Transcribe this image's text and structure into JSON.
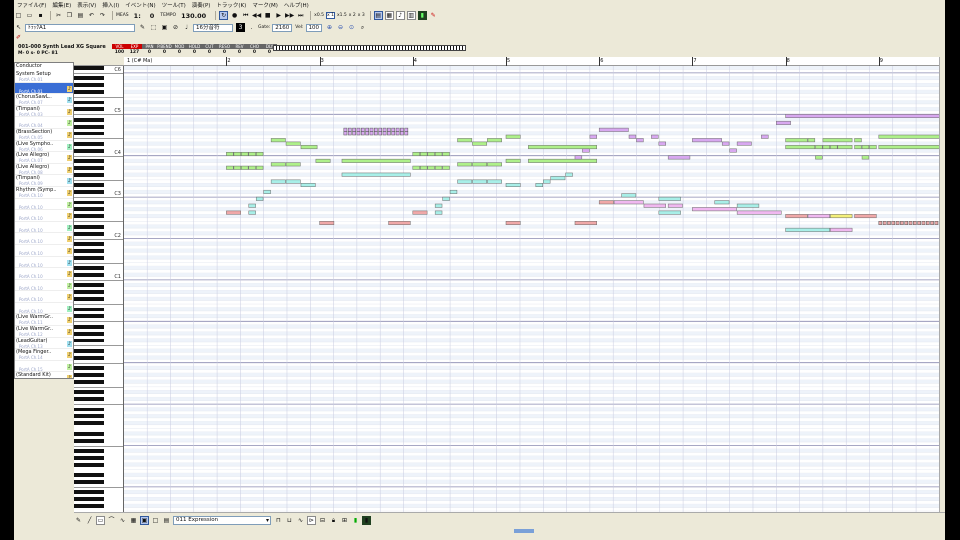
{
  "menu": [
    "ファイル(F)",
    "編集(E)",
    "表示(V)",
    "挿入(I)",
    "イベント(N)",
    "ツール(T)",
    "演奏(P)",
    "トラック(K)",
    "マーク(M)",
    "ヘルプ(H)"
  ],
  "toolbar": {
    "meas_label": "MEAS",
    "position": "1:",
    "tick": "0",
    "tempo_label": "TEMPO",
    "tempo": "130.00",
    "zoom_x05": "x0.5",
    "zoom_x1": "x 1",
    "zoom_x15": "x1.5",
    "zoom_x2": "x 2",
    "zoom_x3": "x 3"
  },
  "toolbar2": {
    "track_select": "ﾄﾗｯｸA1",
    "note_length": "16分音符",
    "gate_label": "Gate:",
    "gate": "2160",
    "vel_label": "Vel:",
    "vel": "100"
  },
  "track": {
    "name": "001-000 Synth Lead XG Square",
    "numbers": "M- 0 s- 0 PC- 81",
    "params": [
      {
        "label": "VOL",
        "value": "100",
        "red": true
      },
      {
        "label": "EXP",
        "value": "127",
        "red": true
      },
      {
        "label": "PAN",
        "value": "0"
      },
      {
        "label": "P.BEND",
        "value": "0"
      },
      {
        "label": "MOD",
        "value": "0"
      },
      {
        "label": "HOLD",
        "value": "0"
      },
      {
        "label": "CUT",
        "value": "0"
      },
      {
        "label": "RESO",
        "value": "0"
      },
      {
        "label": "REV",
        "value": "0"
      },
      {
        "label": "CHO",
        "value": "0"
      },
      {
        "label": "DLY",
        "value": "0"
      }
    ]
  },
  "tracklist": {
    "conductor": "Conductor",
    "tracks": [
      {
        "name": "System Setup",
        "port": "PortA Ch.01",
        "icon": ""
      },
      {
        "name": "",
        "port": "PortA Ch.01",
        "icon": "a",
        "selected": true
      },
      {
        "name": "(ChorusSawL..",
        "port": "PortA Ch.07",
        "icon": "a"
      },
      {
        "name": "(Timpani)",
        "port": "PortA Ch.03",
        "icon": "a"
      },
      {
        "name": "",
        "port": "PortA Ch.04",
        "icon": "a"
      },
      {
        "name": "(BrassSection)",
        "port": "PortA Ch.05",
        "icon": "a"
      },
      {
        "name": "(Live Sympho..",
        "port": "PortA Ch.06",
        "icon": "a"
      },
      {
        "name": "(Live Allegro)",
        "port": "PortA Ch.07",
        "icon": "a"
      },
      {
        "name": "(Live Allegro)",
        "port": "PortA Ch.08",
        "icon": "a"
      },
      {
        "name": "(Timpani)",
        "port": "PortA Ch.09",
        "icon": "a"
      },
      {
        "name": "Rhythm (Symp..",
        "port": "PortA Ch.10",
        "icon": "a"
      },
      {
        "name": "",
        "port": "PortA Ch.10",
        "icon": "a"
      },
      {
        "name": "",
        "port": "PortA Ch.10",
        "icon": "a"
      },
      {
        "name": "",
        "port": "PortA Ch.10",
        "icon": "a"
      },
      {
        "name": "",
        "port": "PortA Ch.10",
        "icon": "a"
      },
      {
        "name": "",
        "port": "PortA Ch.10",
        "icon": "a"
      },
      {
        "name": "",
        "port": "PortA Ch.10",
        "icon": "a"
      },
      {
        "name": "",
        "port": "PortA Ch.10",
        "icon": "a"
      },
      {
        "name": "",
        "port": "PortA Ch.10",
        "icon": "a"
      },
      {
        "name": "",
        "port": "PortA Ch.10",
        "icon": "a"
      },
      {
        "name": "",
        "port": "PortA Ch.10",
        "icon": "a"
      },
      {
        "name": "(Live WarmGr..",
        "port": "PortA Ch.11",
        "icon": "a"
      },
      {
        "name": "(Live WarmGr..",
        "port": "PortA Ch.12",
        "icon": "a"
      },
      {
        "name": "(LeadGuitar)",
        "port": "PortA Ch.13",
        "icon": "a"
      },
      {
        "name": "(Mega Finger..",
        "port": "PortA Ch.14",
        "icon": "a"
      },
      {
        "name": "",
        "port": "PortA Ch.15",
        "icon": "a"
      },
      {
        "name": "(Standard Kit)",
        "port": "PortA Ch.16",
        "icon": "a"
      },
      {
        "name": "",
        "port": "PortA Ch.16",
        "icon": "a"
      }
    ]
  },
  "ruler": {
    "marker": "1 (C# Ma)",
    "measures": [
      "2",
      "3",
      "4",
      "5",
      "6",
      "7",
      "8",
      "9"
    ]
  },
  "keyboard": {
    "octaves": [
      "C7",
      "C6",
      "C5",
      "C4",
      "C3",
      "C2",
      "C1"
    ]
  },
  "colors": {
    "cyan": "#a8efe8",
    "green": "#aef08a",
    "pink": "#f0a8a8",
    "purple": "#d8a8f0",
    "magenta": "#f0b8f0",
    "yellow": "#f4f07a",
    "red": "#e8a8a8"
  },
  "notes": [
    {
      "c": "purple",
      "m": 2.26,
      "p": 80,
      "l": 0.7,
      "t": "blocks"
    },
    {
      "c": "purple",
      "m": 2.26,
      "p": 79,
      "l": 0.7,
      "t": "blocks"
    },
    {
      "c": "green",
      "m": 1.48,
      "p": 77,
      "l": 0.16
    },
    {
      "c": "green",
      "m": 1.64,
      "p": 76,
      "l": 0.16
    },
    {
      "c": "green",
      "m": 1.0,
      "p": 73,
      "l": 0.08
    },
    {
      "c": "green",
      "m": 1.08,
      "p": 73,
      "l": 0.08
    },
    {
      "c": "green",
      "m": 1.16,
      "p": 73,
      "l": 0.08
    },
    {
      "c": "green",
      "m": 1.24,
      "p": 73,
      "l": 0.08
    },
    {
      "c": "green",
      "m": 1.32,
      "p": 73,
      "l": 0.08
    },
    {
      "c": "green",
      "m": 1.8,
      "p": 75,
      "l": 0.18
    },
    {
      "c": "green",
      "m": 1.0,
      "p": 69,
      "l": 0.08
    },
    {
      "c": "green",
      "m": 1.08,
      "p": 69,
      "l": 0.08
    },
    {
      "c": "green",
      "m": 1.16,
      "p": 69,
      "l": 0.08
    },
    {
      "c": "green",
      "m": 1.24,
      "p": 69,
      "l": 0.08
    },
    {
      "c": "green",
      "m": 1.32,
      "p": 69,
      "l": 0.08
    },
    {
      "c": "green",
      "m": 1.48,
      "p": 70,
      "l": 0.16
    },
    {
      "c": "green",
      "m": 1.64,
      "p": 70,
      "l": 0.16
    },
    {
      "c": "green",
      "m": 1.96,
      "p": 71,
      "l": 0.16
    },
    {
      "c": "green",
      "m": 2.24,
      "p": 71,
      "l": 0.74
    },
    {
      "c": "cyan",
      "m": 1.48,
      "p": 65,
      "l": 0.16
    },
    {
      "c": "cyan",
      "m": 1.64,
      "p": 65,
      "l": 0.16
    },
    {
      "c": "cyan",
      "m": 1.8,
      "p": 64,
      "l": 0.16
    },
    {
      "c": "cyan",
      "m": 2.24,
      "p": 67,
      "l": 0.74
    },
    {
      "c": "cyan",
      "m": 1.4,
      "p": 62,
      "l": 0.08
    },
    {
      "c": "cyan",
      "m": 1.32,
      "p": 60,
      "l": 0.08
    },
    {
      "c": "cyan",
      "m": 1.24,
      "p": 58,
      "l": 0.08
    },
    {
      "c": "pink",
      "m": 1.0,
      "p": 56,
      "l": 0.16
    },
    {
      "c": "cyan",
      "m": 1.24,
      "p": 56,
      "l": 0.08
    },
    {
      "c": "pink",
      "m": 2.0,
      "p": 53,
      "l": 0.16
    },
    {
      "c": "pink",
      "m": 2.74,
      "p": 53,
      "l": 0.24
    },
    {
      "c": "green",
      "m": 3.48,
      "p": 77,
      "l": 0.16
    },
    {
      "c": "green",
      "m": 3.64,
      "p": 76,
      "l": 0.16
    },
    {
      "c": "green",
      "m": 3.8,
      "p": 77,
      "l": 0.16
    },
    {
      "c": "green",
      "m": 3.0,
      "p": 73,
      "l": 0.08
    },
    {
      "c": "green",
      "m": 3.08,
      "p": 73,
      "l": 0.08
    },
    {
      "c": "green",
      "m": 3.16,
      "p": 73,
      "l": 0.08
    },
    {
      "c": "green",
      "m": 3.24,
      "p": 73,
      "l": 0.08
    },
    {
      "c": "green",
      "m": 3.32,
      "p": 73,
      "l": 0.08
    },
    {
      "c": "green",
      "m": 3.0,
      "p": 69,
      "l": 0.08
    },
    {
      "c": "green",
      "m": 3.08,
      "p": 69,
      "l": 0.08
    },
    {
      "c": "green",
      "m": 3.16,
      "p": 69,
      "l": 0.08
    },
    {
      "c": "green",
      "m": 3.24,
      "p": 69,
      "l": 0.08
    },
    {
      "c": "green",
      "m": 3.32,
      "p": 69,
      "l": 0.08
    },
    {
      "c": "green",
      "m": 3.48,
      "p": 70,
      "l": 0.16
    },
    {
      "c": "green",
      "m": 3.64,
      "p": 70,
      "l": 0.16
    },
    {
      "c": "green",
      "m": 3.8,
      "p": 70,
      "l": 0.16
    },
    {
      "c": "cyan",
      "m": 3.48,
      "p": 65,
      "l": 0.16
    },
    {
      "c": "cyan",
      "m": 3.64,
      "p": 65,
      "l": 0.16
    },
    {
      "c": "cyan",
      "m": 3.8,
      "p": 65,
      "l": 0.16
    },
    {
      "c": "cyan",
      "m": 3.4,
      "p": 62,
      "l": 0.08
    },
    {
      "c": "cyan",
      "m": 3.32,
      "p": 60,
      "l": 0.08
    },
    {
      "c": "cyan",
      "m": 3.24,
      "p": 58,
      "l": 0.08
    },
    {
      "c": "pink",
      "m": 3.0,
      "p": 56,
      "l": 0.16
    },
    {
      "c": "cyan",
      "m": 3.24,
      "p": 56,
      "l": 0.08
    },
    {
      "c": "pink",
      "m": 4.0,
      "p": 53,
      "l": 0.16
    },
    {
      "c": "pink",
      "m": 4.74,
      "p": 53,
      "l": 0.24
    },
    {
      "c": "green",
      "m": 4.0,
      "p": 78,
      "l": 0.16
    },
    {
      "c": "green",
      "m": 4.0,
      "p": 71,
      "l": 0.16
    },
    {
      "c": "green",
      "m": 4.24,
      "p": 75,
      "l": 0.74
    },
    {
      "c": "green",
      "m": 4.24,
      "p": 71,
      "l": 0.74
    },
    {
      "c": "cyan",
      "m": 4.0,
      "p": 64,
      "l": 0.16
    },
    {
      "c": "cyan",
      "m": 4.32,
      "p": 64,
      "l": 0.08
    },
    {
      "c": "cyan",
      "m": 4.4,
      "p": 65,
      "l": 0.08
    },
    {
      "c": "cyan",
      "m": 4.48,
      "p": 66,
      "l": 0.16
    },
    {
      "c": "cyan",
      "m": 4.64,
      "p": 67,
      "l": 0.08
    },
    {
      "c": "purple",
      "m": 4.74,
      "p": 72,
      "l": 0.08
    },
    {
      "c": "purple",
      "m": 4.82,
      "p": 74,
      "l": 0.08
    },
    {
      "c": "purple",
      "m": 4.9,
      "p": 78,
      "l": 0.08
    },
    {
      "c": "purple",
      "m": 5.0,
      "p": 80,
      "l": 0.32
    },
    {
      "c": "purple",
      "m": 5.32,
      "p": 78,
      "l": 0.08
    },
    {
      "c": "purple",
      "m": 5.4,
      "p": 77,
      "l": 0.08
    },
    {
      "c": "purple",
      "m": 5.56,
      "p": 78,
      "l": 0.08
    },
    {
      "c": "purple",
      "m": 5.64,
      "p": 76,
      "l": 0.08
    },
    {
      "c": "purple",
      "m": 5.74,
      "p": 72,
      "l": 0.24
    },
    {
      "c": "purple",
      "m": 6.0,
      "p": 77,
      "l": 0.32
    },
    {
      "c": "purple",
      "m": 6.32,
      "p": 76,
      "l": 0.08
    },
    {
      "c": "purple",
      "m": 6.4,
      "p": 74,
      "l": 0.08
    },
    {
      "c": "purple",
      "m": 6.48,
      "p": 76,
      "l": 0.16
    },
    {
      "c": "purple",
      "m": 6.74,
      "p": 78,
      "l": 0.08
    },
    {
      "c": "purple",
      "m": 6.9,
      "p": 82,
      "l": 0.16
    },
    {
      "c": "pink",
      "m": 5.0,
      "p": 59,
      "l": 0.16
    },
    {
      "c": "magenta",
      "m": 5.16,
      "p": 59,
      "l": 0.32
    },
    {
      "c": "cyan",
      "m": 5.24,
      "p": 61,
      "l": 0.16
    },
    {
      "c": "magenta",
      "m": 5.48,
      "p": 58,
      "l": 0.24
    },
    {
      "c": "cyan",
      "m": 5.64,
      "p": 60,
      "l": 0.24
    },
    {
      "c": "magenta",
      "m": 5.74,
      "p": 58,
      "l": 0.16
    },
    {
      "c": "cyan",
      "m": 5.64,
      "p": 56,
      "l": 0.24
    },
    {
      "c": "magenta",
      "m": 6.0,
      "p": 57,
      "l": 0.48
    },
    {
      "c": "cyan",
      "m": 6.24,
      "p": 59,
      "l": 0.16
    },
    {
      "c": "cyan",
      "m": 6.48,
      "p": 58,
      "l": 0.24
    },
    {
      "c": "magenta",
      "m": 6.48,
      "p": 56,
      "l": 0.48
    },
    {
      "c": "purple",
      "m": 7.0,
      "p": 84,
      "l": 1.74
    },
    {
      "c": "green",
      "m": 7.0,
      "p": 77,
      "l": 0.24
    },
    {
      "c": "green",
      "m": 7.24,
      "p": 77,
      "l": 0.08
    },
    {
      "c": "green",
      "m": 7.4,
      "p": 77,
      "l": 0.32
    },
    {
      "c": "green",
      "m": 7.74,
      "p": 77,
      "l": 0.08
    },
    {
      "c": "green",
      "m": 7.0,
      "p": 75,
      "l": 0.32
    },
    {
      "c": "green",
      "m": 7.32,
      "p": 75,
      "l": 0.08
    },
    {
      "c": "green",
      "m": 7.4,
      "p": 75,
      "l": 0.08
    },
    {
      "c": "green",
      "m": 7.48,
      "p": 75,
      "l": 0.08
    },
    {
      "c": "green",
      "m": 7.56,
      "p": 75,
      "l": 0.16
    },
    {
      "c": "green",
      "m": 7.74,
      "p": 75,
      "l": 0.08
    },
    {
      "c": "green",
      "m": 7.82,
      "p": 75,
      "l": 0.08
    },
    {
      "c": "green",
      "m": 7.9,
      "p": 75,
      "l": 0.08
    },
    {
      "c": "green",
      "m": 8.0,
      "p": 78,
      "l": 0.74
    },
    {
      "c": "green",
      "m": 8.0,
      "p": 75,
      "l": 0.74
    },
    {
      "c": "green",
      "m": 7.32,
      "p": 72,
      "l": 0.08
    },
    {
      "c": "green",
      "m": 7.82,
      "p": 72,
      "l": 0.08
    },
    {
      "c": "pink",
      "m": 7.0,
      "p": 55,
      "l": 0.24
    },
    {
      "c": "magenta",
      "m": 7.24,
      "p": 55,
      "l": 0.24
    },
    {
      "c": "yellow",
      "m": 7.48,
      "p": 55,
      "l": 0.24
    },
    {
      "c": "pink",
      "m": 7.74,
      "p": 55,
      "l": 0.24
    },
    {
      "c": "cyan",
      "m": 7.0,
      "p": 51,
      "l": 0.48
    },
    {
      "c": "magenta",
      "m": 7.48,
      "p": 51,
      "l": 0.24
    },
    {
      "c": "red",
      "m": 8.0,
      "p": 53,
      "l": 0.74,
      "t": "blocks"
    }
  ]
}
